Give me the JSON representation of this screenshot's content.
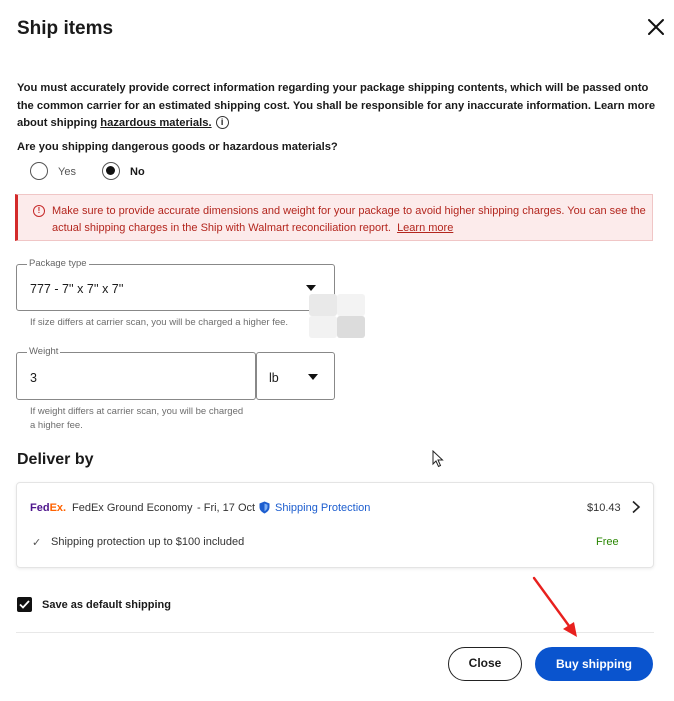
{
  "dialog": {
    "title": "Ship items",
    "close_icon": "close-icon"
  },
  "notice": {
    "text_part1": "You must accurately provide correct information regarding your package shipping contents, which will be passed onto the common carrier for an estimated shipping cost. You shall be responsible for any inaccurate information. Learn more about shipping ",
    "link": "hazardous materials.",
    "info_icon": "ⓘ"
  },
  "hazmat": {
    "question": "Are you shipping dangerous goods or hazardous materials?",
    "options": [
      {
        "label": "Yes",
        "selected": false
      },
      {
        "label": "No",
        "selected": true
      }
    ]
  },
  "alert": {
    "icon": "!",
    "text": "Make sure to provide accurate dimensions and weight for your package to avoid higher shipping charges. You can see the actual shipping charges in the Ship with Walmart reconciliation report.",
    "link": "Learn more",
    "color": "#b3261e"
  },
  "package": {
    "label": "Package type",
    "value": "777 - 7'' x 7'' x 7''",
    "help": "If size differs at carrier scan, you will be charged a higher fee."
  },
  "weight": {
    "label": "Weight",
    "value": "3",
    "unit": "lb",
    "help_line1": "If weight differs at carrier scan, you will be charged",
    "help_line2": "a higher fee."
  },
  "deliver": {
    "heading": "Deliver by",
    "carrier_logo_fd": "Fed",
    "carrier_logo_ex": "Ex.",
    "service": "FedEx Ground Economy",
    "date": "- Fri, 17 Oct",
    "protection_label": "Shipping Protection",
    "price": "$10.43",
    "protection_note": "Shipping protection up to $100 included",
    "protection_price": "Free",
    "check_icon": "✓",
    "chevron": "›"
  },
  "default_shipping": {
    "label": "Save as default shipping",
    "checked": true
  },
  "buttons": {
    "close": "Close",
    "buy": "Buy shipping",
    "buy_color": "#0a54ce"
  }
}
